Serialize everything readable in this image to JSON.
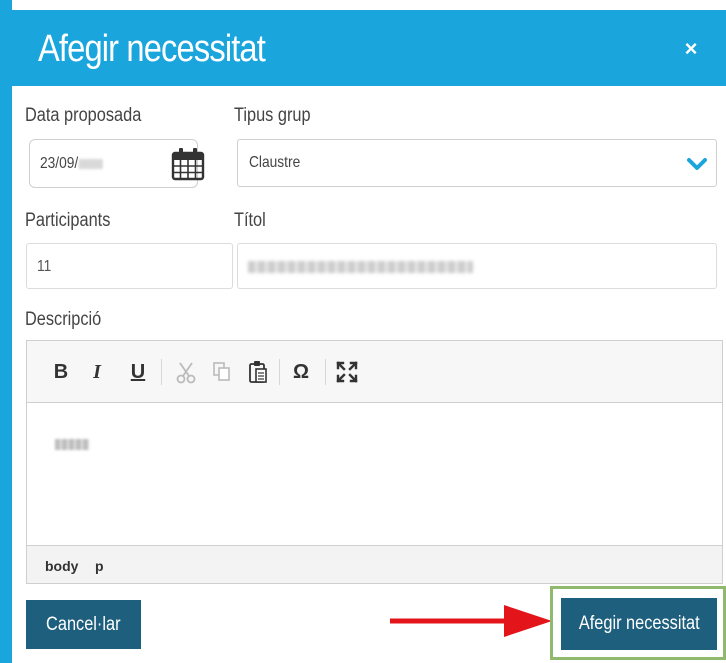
{
  "dialog": {
    "title": "Afegir necessitat",
    "close_symbol": "×"
  },
  "form": {
    "date_label": "Data proposada",
    "date_value": "23/09/",
    "group_type_label": "Tipus grup",
    "group_type_value": "Claustre",
    "participants_label": "Participants",
    "participants_value": "11",
    "title_label": "Títol",
    "description_label": "Descripció"
  },
  "editor": {
    "toolbar": {
      "bold": "B",
      "italic": "I",
      "underline": "U",
      "special_char": "Ω"
    },
    "statusbar": [
      "body",
      "p"
    ]
  },
  "buttons": {
    "cancel": "Cancel·lar",
    "submit": "Afegir necessitat"
  },
  "colors": {
    "header": "#1aa6dc",
    "button": "#1d5f7d",
    "arrow": "#e3151b",
    "highlight": "#8fb96c",
    "chevron": "#1aa6dc"
  },
  "icons": [
    "calendar-icon",
    "chevron-down-icon",
    "cut-icon",
    "copy-icon",
    "paste-icon",
    "fullscreen-icon",
    "close-icon"
  ]
}
